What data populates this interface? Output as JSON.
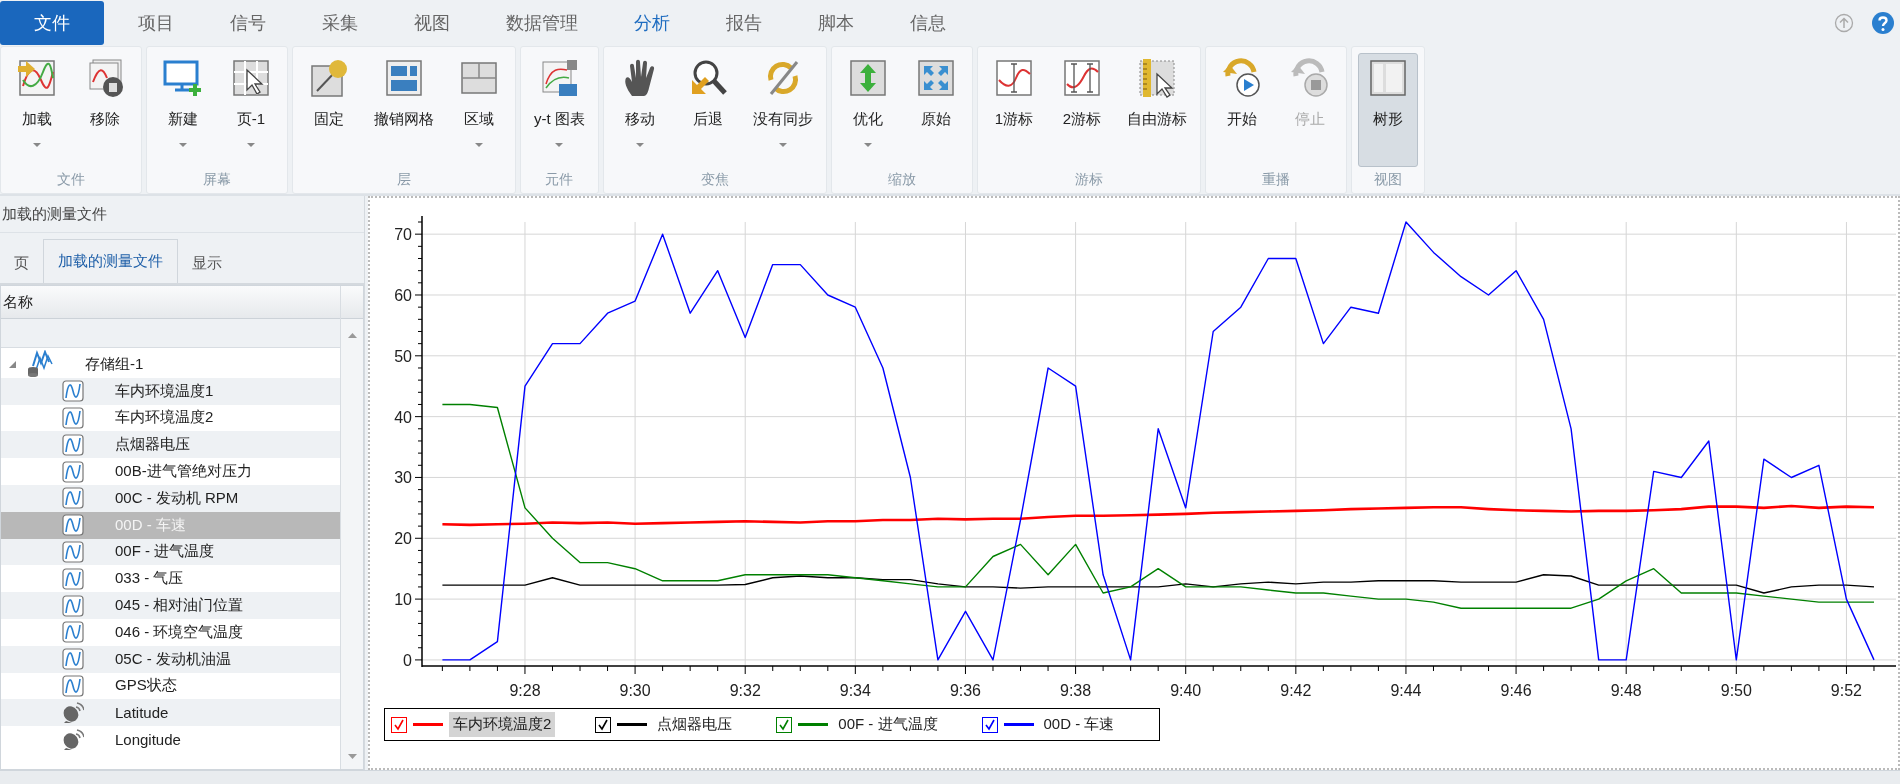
{
  "menu_tabs": [
    {
      "label": "文件",
      "kind": "file",
      "selected": false
    },
    {
      "label": "项目",
      "kind": "tab",
      "selected": false
    },
    {
      "label": "信号",
      "kind": "tab",
      "selected": false
    },
    {
      "label": "采集",
      "kind": "tab",
      "selected": false
    },
    {
      "label": "视图",
      "kind": "tab",
      "selected": false
    },
    {
      "label": "数据管理",
      "kind": "tab",
      "selected": false
    },
    {
      "label": "分析",
      "kind": "tab",
      "selected": true
    },
    {
      "label": "报告",
      "kind": "tab",
      "selected": false
    },
    {
      "label": "脚本",
      "kind": "tab",
      "selected": false
    },
    {
      "label": "信息",
      "kind": "tab",
      "selected": false
    }
  ],
  "ribbon": {
    "groups": [
      {
        "label": "文件",
        "buttons": [
          {
            "label": "加载",
            "dropdown": true,
            "disabled": false,
            "pressed": false
          },
          {
            "label": "移除",
            "dropdown": false,
            "disabled": false,
            "pressed": false
          }
        ]
      },
      {
        "label": "屏幕",
        "buttons": [
          {
            "label": "新建",
            "dropdown": true,
            "disabled": false,
            "pressed": false
          },
          {
            "label": "页-1",
            "dropdown": true,
            "disabled": false,
            "pressed": false
          }
        ]
      },
      {
        "label": "层",
        "buttons": [
          {
            "label": "固定",
            "dropdown": false,
            "disabled": false,
            "pressed": false
          },
          {
            "label": "撤销网格",
            "dropdown": false,
            "disabled": false,
            "pressed": false
          },
          {
            "label": "区域",
            "dropdown": true,
            "disabled": false,
            "pressed": false
          }
        ]
      },
      {
        "label": "元件",
        "buttons": [
          {
            "label": "y-t 图表",
            "dropdown": true,
            "disabled": false,
            "pressed": false
          }
        ]
      },
      {
        "label": "变焦",
        "buttons": [
          {
            "label": "移动",
            "dropdown": true,
            "disabled": false,
            "pressed": false
          },
          {
            "label": "后退",
            "dropdown": false,
            "disabled": false,
            "pressed": false
          },
          {
            "label": "没有同步",
            "dropdown": true,
            "disabled": false,
            "pressed": false
          }
        ]
      },
      {
        "label": "缩放",
        "buttons": [
          {
            "label": "优化",
            "dropdown": true,
            "disabled": false,
            "pressed": false
          },
          {
            "label": "原始",
            "dropdown": false,
            "disabled": false,
            "pressed": false
          }
        ]
      },
      {
        "label": "游标",
        "buttons": [
          {
            "label": "1游标",
            "dropdown": false,
            "disabled": false,
            "pressed": false
          },
          {
            "label": "2游标",
            "dropdown": false,
            "disabled": false,
            "pressed": false
          },
          {
            "label": "自由游标",
            "dropdown": false,
            "disabled": false,
            "pressed": false
          }
        ]
      },
      {
        "label": "重播",
        "buttons": [
          {
            "label": "开始",
            "dropdown": false,
            "disabled": false,
            "pressed": false
          },
          {
            "label": "停止",
            "dropdown": false,
            "disabled": true,
            "pressed": false
          }
        ]
      },
      {
        "label": "视图",
        "buttons": [
          {
            "label": "树形",
            "dropdown": false,
            "disabled": false,
            "pressed": true
          }
        ]
      }
    ]
  },
  "measurement_panel": {
    "title": "加载的测量文件",
    "tabs": [
      {
        "label": "页",
        "selected": false
      },
      {
        "label": "加载的测量文件",
        "selected": true
      },
      {
        "label": "显示",
        "selected": false
      }
    ],
    "column": "名称",
    "tree": [
      {
        "label": "存储组-1",
        "kind": "group",
        "expanded": true,
        "selected": false,
        "children": [
          {
            "label": "车内环境温度1",
            "kind": "channel",
            "selected": false
          },
          {
            "label": "车内环境温度2",
            "kind": "channel",
            "selected": false
          },
          {
            "label": "点烟器电压",
            "kind": "channel",
            "selected": false
          },
          {
            "label": "00B-进气管绝对压力",
            "kind": "channel",
            "selected": false
          },
          {
            "label": "00C - 发动机 RPM",
            "kind": "channel",
            "selected": false
          },
          {
            "label": "00D - 车速",
            "kind": "channel",
            "selected": true
          },
          {
            "label": "00F - 进气温度",
            "kind": "channel",
            "selected": false
          },
          {
            "label": "033 - 气压",
            "kind": "channel",
            "selected": false
          },
          {
            "label": "045 - 相对油门位置",
            "kind": "channel",
            "selected": false
          },
          {
            "label": "046 - 环境空气温度",
            "kind": "channel",
            "selected": false
          },
          {
            "label": "05C - 发动机油温",
            "kind": "channel",
            "selected": false
          },
          {
            "label": "GPS状态",
            "kind": "channel",
            "selected": false
          },
          {
            "label": "Latitude",
            "kind": "gps",
            "selected": false
          },
          {
            "label": "Longitude",
            "kind": "gps",
            "selected": false
          }
        ]
      }
    ]
  },
  "chart": {
    "chart_data": {
      "type": "line",
      "categories": [
        null,
        null,
        null,
        "9:28",
        null,
        null,
        null,
        "9:30",
        null,
        null,
        null,
        "9:32",
        null,
        null,
        null,
        "9:34",
        null,
        null,
        null,
        "9:36",
        null,
        null,
        null,
        "9:38",
        null,
        null,
        null,
        "9:40",
        null,
        null,
        null,
        "9:42",
        null,
        null,
        null,
        "9:44",
        null,
        null,
        null,
        "9:46",
        null,
        null,
        null,
        "9:48",
        null,
        null,
        null,
        "9:50",
        null,
        null,
        null,
        "9:52",
        null
      ],
      "series": [
        {
          "name": "车内环境温度2",
          "color": "#ff0000",
          "values": [
            22.3,
            22.2,
            22.3,
            22.4,
            22.6,
            22.5,
            22.6,
            22.4,
            22.5,
            22.6,
            22.7,
            22.8,
            22.7,
            22.6,
            22.8,
            22.8,
            23,
            23,
            23.2,
            23.1,
            23.2,
            23.2,
            23.5,
            23.7,
            23.7,
            23.8,
            23.9,
            24,
            24.2,
            24.3,
            24.4,
            24.5,
            24.6,
            24.8,
            24.9,
            25,
            25.1,
            25.1,
            24.8,
            24.6,
            24.5,
            24.4,
            24.5,
            24.5,
            24.6,
            24.8,
            25.2,
            25.2,
            25,
            25.3,
            25,
            25.2,
            25.1
          ]
        },
        {
          "name": "点烟器电压",
          "color": "#000000",
          "values": [
            12.3,
            12.3,
            12.3,
            12.3,
            13.5,
            12.3,
            12.3,
            12.3,
            12.3,
            12.3,
            12.3,
            12.4,
            13.5,
            13.8,
            13.5,
            13.5,
            13.2,
            13.2,
            12.5,
            12,
            12,
            11.8,
            12,
            12,
            12,
            12,
            12,
            12.5,
            12,
            12.5,
            12.8,
            12.5,
            12.8,
            12.8,
            13,
            13,
            13,
            12.8,
            12.8,
            12.8,
            14,
            13.8,
            12.3,
            12.3,
            12.3,
            12.3,
            12.3,
            12.3,
            11,
            12,
            12.3,
            12.3,
            12
          ]
        },
        {
          "name": "00F - 进气温度",
          "color": "#008000",
          "values": [
            42,
            42,
            41.5,
            25,
            20,
            16,
            16,
            15,
            13,
            13,
            13,
            14,
            14,
            14,
            14,
            13.5,
            13,
            12.5,
            12,
            12,
            17,
            19,
            14,
            19,
            11,
            12,
            15,
            12,
            12,
            12,
            11.5,
            11,
            11,
            10.5,
            10,
            10,
            9.5,
            8.5,
            8.5,
            8.5,
            8.5,
            8.5,
            10,
            13,
            15,
            11,
            11,
            11,
            10.5,
            10,
            9.5,
            9.5,
            9.5
          ]
        },
        {
          "name": "00D - 车速",
          "color": "#0000ff",
          "values": [
            0,
            0,
            3,
            45,
            52,
            52,
            57,
            59,
            70,
            57,
            64,
            53,
            65,
            65,
            60,
            58,
            48,
            30,
            0,
            8,
            0,
            23,
            48,
            45,
            14,
            0,
            38,
            25,
            54,
            58,
            66,
            66,
            52,
            58,
            57,
            72,
            67,
            63,
            60,
            64,
            56,
            38,
            0,
            0,
            31,
            30,
            36,
            0,
            33,
            30,
            32,
            10,
            0
          ]
        }
      ],
      "grid": true,
      "ylim": [
        -1,
        72
      ],
      "yticks": [
        0,
        10,
        20,
        30,
        40,
        50,
        60,
        70
      ]
    },
    "legend": [
      {
        "checked": true,
        "selected": true
      },
      {
        "checked": true,
        "selected": false
      },
      {
        "checked": true,
        "selected": false
      },
      {
        "checked": true,
        "selected": false
      }
    ]
  }
}
